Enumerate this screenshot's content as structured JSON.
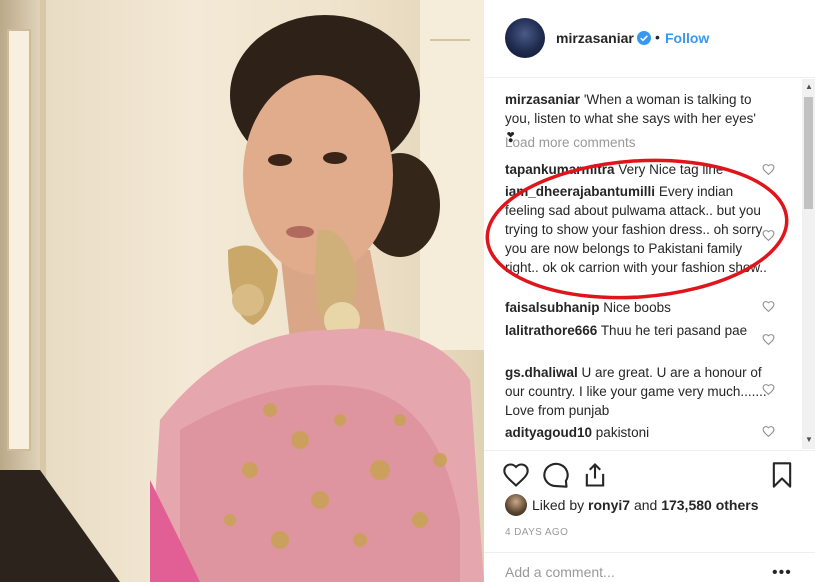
{
  "post": {
    "username": "mirzasaniar",
    "follow_label": "Follow",
    "separator": "•",
    "caption_user": "mirzasaniar",
    "caption_text": "'When a woman is talking to you, listen to what she says with her eyes' ❣"
  },
  "load_more": "Load more comments",
  "comments": [
    {
      "user": "tapankumarmitra",
      "text": "Very Nice tag line"
    },
    {
      "user": "iam_dheerajabantumilli",
      "text": "Every indian feeling sad about pulwama attack.. but you trying to show your fashion dress.. oh sorry you are now belongs to Pakistani family right.. ok ok carrion with your fashion show.."
    },
    {
      "user": "faisalsubhanip",
      "text": "Nice boobs"
    },
    {
      "user": "lalitrathore666",
      "text": "Thuu he teri pasand pae"
    },
    {
      "user": "gs.dhaliwal",
      "text": "U are great. U are a honour of our country. I like your game very much....... Love from punjab"
    },
    {
      "user": "adityagoud10",
      "text": "pakistoni"
    }
  ],
  "likes": {
    "prefix": "Liked by",
    "user": "ronyi7",
    "middle": "and",
    "count": "173,580 others"
  },
  "time_ago": "4 DAYS AGO",
  "add_comment_placeholder": "Add a comment...",
  "more_label": "•••",
  "icons": [
    "verified-badge-icon",
    "heart-icon",
    "comment-icon",
    "share-icon",
    "bookmark-icon"
  ],
  "colors": {
    "link": "#3897f0",
    "annotation": "#e0151b",
    "muted": "#999999"
  }
}
